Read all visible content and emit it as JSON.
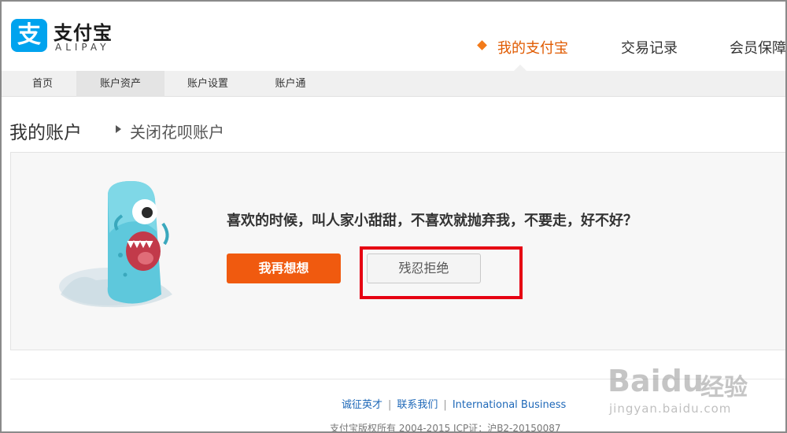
{
  "header": {
    "logo_cn": "支付宝",
    "logo_en": "ALIPAY",
    "logo_mark": "支",
    "nav": [
      {
        "label": "我的支付宝",
        "active": true
      },
      {
        "label": "交易记录"
      },
      {
        "label": "会员保障"
      }
    ]
  },
  "subnav": {
    "items": [
      {
        "label": "首页"
      },
      {
        "label": "账户资产",
        "active": true
      },
      {
        "label": "账户设置"
      },
      {
        "label": "账户通"
      }
    ]
  },
  "breadcrumb": {
    "title": "我的账户",
    "current": "关闭花呗账户"
  },
  "main": {
    "question": "喜欢的时候，叫人家小甜甜，不喜欢就抛弃我，不要走，好不好？",
    "primary_button": "我再想想",
    "secondary_button": "残忍拒绝",
    "mascot_icon": "blue-monster-mascot"
  },
  "footer": {
    "links": [
      "诚征英才",
      "联系我们",
      "International Business"
    ],
    "copyright": "支付宝版权所有 2004-2015 ICP证：沪B2-20150087"
  },
  "watermark": {
    "logo": "Baidu",
    "cn": "经验",
    "url": "jingyan.baidu.com"
  },
  "colors": {
    "brand_blue": "#00a3ee",
    "accent_orange": "#f05a0f",
    "highlight_red": "#e60012",
    "link_blue": "#1e68b8"
  }
}
